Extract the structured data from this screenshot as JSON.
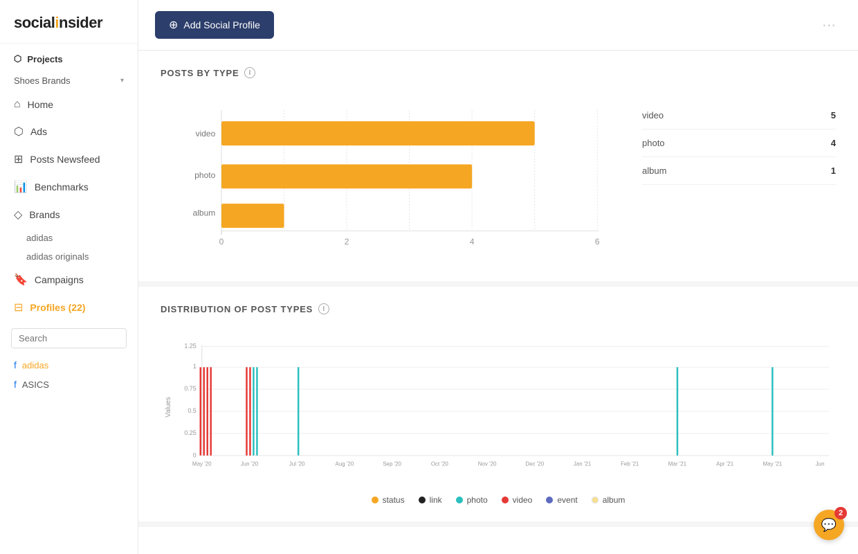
{
  "app": {
    "name": "socialinsider",
    "logo_highlight": "i"
  },
  "sidebar": {
    "projects_label": "Projects",
    "project_name": "Shoes Brands",
    "nav_items": [
      {
        "id": "home",
        "label": "Home",
        "icon": "home"
      },
      {
        "id": "ads",
        "label": "Ads",
        "icon": "layers"
      },
      {
        "id": "posts-newsfeed",
        "label": "Posts Newsfeed",
        "icon": "grid"
      },
      {
        "id": "benchmarks",
        "label": "Benchmarks",
        "icon": "bar-chart"
      },
      {
        "id": "brands",
        "label": "Brands",
        "icon": "tag"
      }
    ],
    "brand_items": [
      {
        "label": "adidas"
      },
      {
        "label": "adidas originals"
      }
    ],
    "campaigns_label": "Campaigns",
    "profiles_label": "Profiles (22)",
    "search_placeholder": "Search",
    "profile_items": [
      {
        "label": "adidas",
        "platform": "facebook"
      },
      {
        "label": "ASICS",
        "platform": "facebook"
      }
    ]
  },
  "header": {
    "add_profile_label": "Add Social Profile",
    "dots": "..."
  },
  "posts_by_type": {
    "title": "POSTS BY TYPE",
    "bars": [
      {
        "label": "video",
        "value": 5,
        "max": 6
      },
      {
        "label": "photo",
        "value": 4,
        "max": 6
      },
      {
        "label": "album",
        "value": 1,
        "max": 6
      }
    ],
    "legend": [
      {
        "label": "video",
        "count": 5
      },
      {
        "label": "photo",
        "count": 4
      },
      {
        "label": "album",
        "count": 1
      }
    ],
    "color": "#f5a623",
    "x_ticks": [
      0,
      2,
      4,
      6
    ]
  },
  "distribution": {
    "title": "DISTRIBUTION OF POST TYPES",
    "y_label": "Values",
    "y_ticks": [
      0,
      0.25,
      0.5,
      0.75,
      1,
      1.25
    ],
    "x_labels": [
      "May '20",
      "Jun '20",
      "Jul '20",
      "Aug '20",
      "Sep '20",
      "Oct '20",
      "Nov '20",
      "Dec '20",
      "Jan '21",
      "Feb '21",
      "Mar '21",
      "Apr '21",
      "May '21",
      "Jun"
    ],
    "legend": [
      {
        "label": "status",
        "color": "#f5a623"
      },
      {
        "label": "link",
        "color": "#222"
      },
      {
        "label": "photo",
        "color": "#2bbfbf"
      },
      {
        "label": "video",
        "color": "#e53935"
      },
      {
        "label": "event",
        "color": "#5c6bc0"
      },
      {
        "label": "album",
        "color": "#f9e090"
      }
    ]
  },
  "chat": {
    "badge_count": "2"
  }
}
